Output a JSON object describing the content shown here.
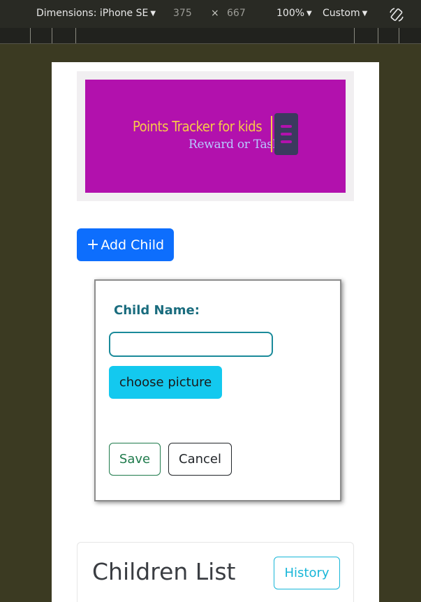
{
  "devtools": {
    "dimensions_label": "Dimensions: iPhone SE",
    "width": "375",
    "times": "×",
    "height": "667",
    "zoom": "100%",
    "throttle": "Custom",
    "caret": "▼"
  },
  "banner": {
    "title": "Points Tracker for kids",
    "subtitle": "Reward or Task",
    "background": "#b211ad"
  },
  "add_child": {
    "icon": "+",
    "label": "Add Child"
  },
  "modal": {
    "name_label": "Child Name:",
    "name_value": "",
    "choose_picture": "choose picture",
    "save": "Save",
    "cancel": "Cancel"
  },
  "children_list": {
    "title": "Children List",
    "history": "History"
  },
  "colors": {
    "primary": "#0d6efd",
    "info": "#13c9ef",
    "success": "#1e7a4b",
    "brand": "#b211ad"
  }
}
